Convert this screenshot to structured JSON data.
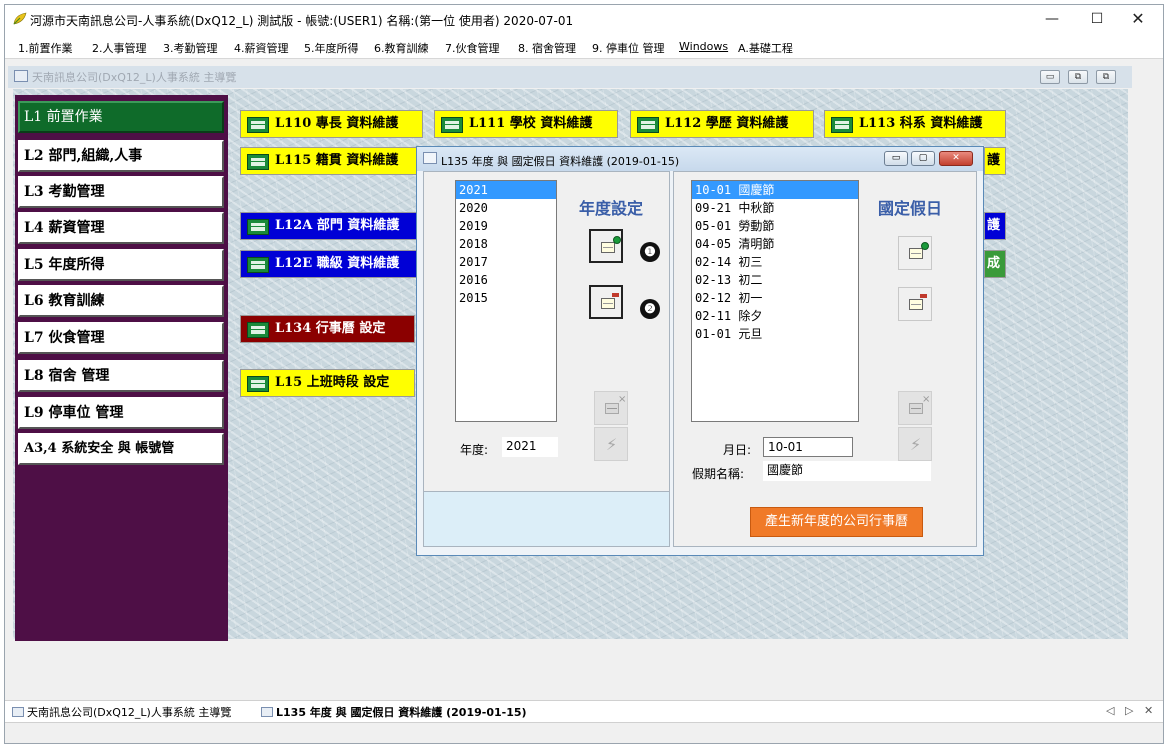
{
  "window": {
    "title": "河源市天南訊息公司-人事系統(DxQ12_L) 測試版 - 帳號:(USER1) 名稱:(第一位 使用者) 2020-07-01",
    "min": "—",
    "max": "☐",
    "close": "✕"
  },
  "menu": [
    "1.前置作業",
    "2.人事管理",
    "3.考勤管理",
    "4.薪資管理",
    "5.年度所得",
    "6.教育訓練",
    "7.伙食管理",
    "8. 宿舍管理",
    "9. 停車位 管理",
    "Windows",
    "A.基礎工程"
  ],
  "child": {
    "title": "天南訊息公司(DxQ12_L)人事系統 主導覽",
    "btn_min": "▭",
    "btn_restore": "⧉",
    "btn_close": "⧉"
  },
  "nav": [
    "L1  前置作業",
    "L2  部門,組織,人事",
    "L3  考勤管理",
    "L4  薪資管理",
    "L5  年度所得",
    "L6  教育訓練",
    "L7  伙食管理",
    "L8  宿舍  管理",
    "L9  停車位  管理",
    "A3,4  系統安全  與  帳號管"
  ],
  "modules": {
    "l110": "L110  專長  資料維護",
    "l111": "L111  學校  資料維護",
    "l112": "L112  學歷  資料維護",
    "l113": "L113  科系  資料維護",
    "l115": "L115  籍貫  資料維護",
    "l115b": "護",
    "l12a": "L12A  部門  資料維護",
    "l12ab": "護",
    "l12e": "L12E  職級  資料維護",
    "l12eb": "成",
    "l134": "L134  行事曆  設定",
    "l15": "L15  上班時段  設定"
  },
  "dialog": {
    "title": "L135 年度 與 國定假日 資料維護 (2019-01-15)",
    "years_title": "年度設定",
    "years": [
      "2021",
      "2020",
      "2019",
      "2018",
      "2017",
      "2016",
      "2015"
    ],
    "year_label": "年度:",
    "year_value": "2021",
    "holidays_title": "國定假日",
    "holidays": [
      "10-01  國慶節",
      "09-21  中秋節",
      "05-01   勞動節",
      "04-05  清明節",
      "02-14  初三",
      "02-13  初二",
      "02-12  初一",
      "02-11  除夕",
      "01-01  元旦"
    ],
    "date_label": "月日:",
    "date_value": "10-01",
    "name_label": "假期名稱:",
    "name_value": "國慶節",
    "generate_button": "產生新年度的公司行事曆",
    "badge1": "❶",
    "badge2": "❷",
    "btn_min": "▭",
    "btn_restore": "▢",
    "btn_close": "✕"
  },
  "taskbar": {
    "item1": "天南訊息公司(DxQ12_L)人事系統 主導覽",
    "item2": "L135 年度 與 國定假日 資料維護 (2019-01-15)",
    "prev": "◁",
    "next": "▷",
    "close": "✕"
  },
  "colors": {
    "nav_active": "#0f6b2a",
    "nav_bg": "#4e0f46",
    "module_yellow": "#ffff00",
    "module_blue": "#0000d6",
    "module_darkred": "#8b0000",
    "generate_button": "#f07a28",
    "section_title": "#3a5ea8",
    "list_selection": "#3399ff"
  }
}
